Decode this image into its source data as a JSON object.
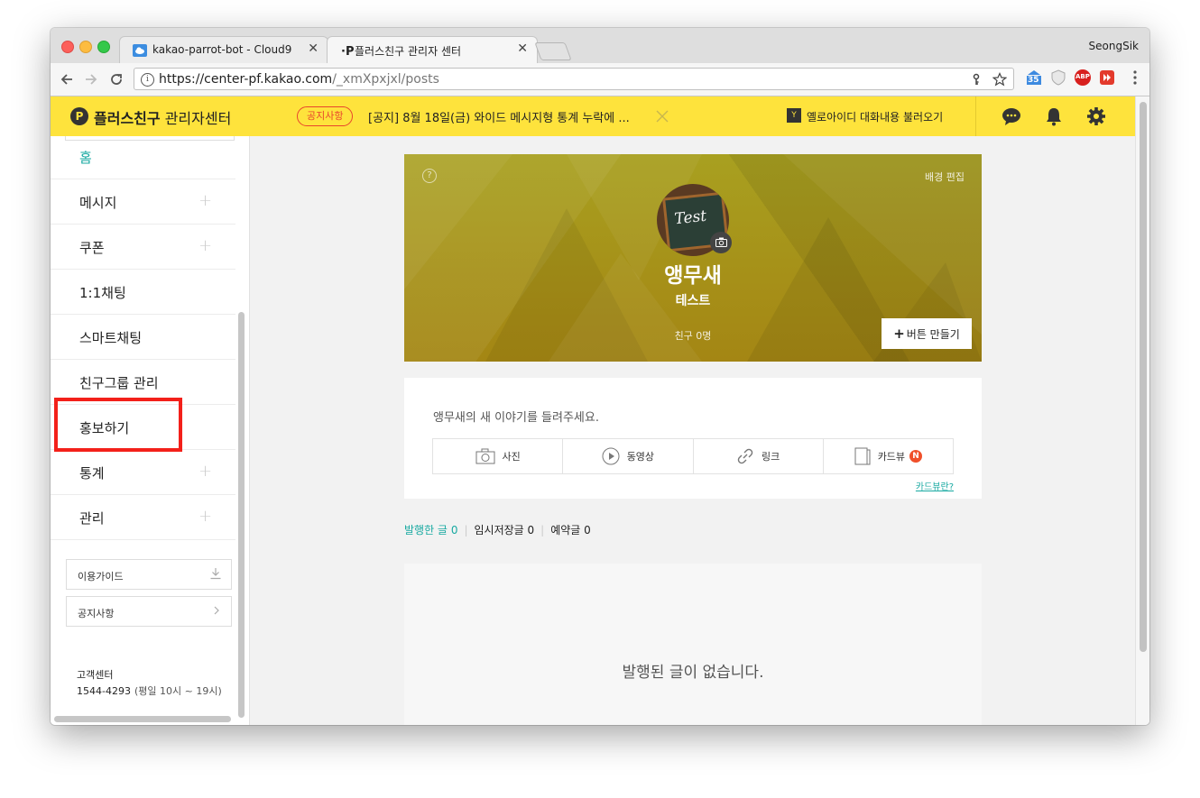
{
  "browser": {
    "tabs": [
      {
        "title": "kakao-parrot-bot - Cloud9",
        "active": false
      },
      {
        "title": "플러스친구 관리자 센터",
        "active": true
      }
    ],
    "close_glyph": "✕",
    "profile_name": "SeongSik",
    "url_host": "https://center-pf.kakao.com",
    "url_path": "/_xmXpxjxl/posts",
    "ext_badge_count": "35",
    "abp_label": "ABP"
  },
  "header": {
    "brand_bold": "플러스친구",
    "brand_rest": " 관리자센터",
    "notice_badge": "공지사항",
    "notice_text": "[공지] 8월 18일(금) 와이드 메시지형 통계 누락에 ...",
    "yellow_id_label": "옐로아이디 대화내용 불러오기"
  },
  "sidebar": {
    "items": [
      {
        "label": "홈",
        "active": true,
        "expandable": false
      },
      {
        "label": "메시지",
        "active": false,
        "expandable": true
      },
      {
        "label": "쿠폰",
        "active": false,
        "expandable": true
      },
      {
        "label": "1:1채팅",
        "active": false,
        "expandable": false
      },
      {
        "label": "스마트채팅",
        "active": false,
        "expandable": false
      },
      {
        "label": "친구그룹 관리",
        "active": false,
        "expandable": false
      },
      {
        "label": "홍보하기",
        "active": false,
        "expandable": false
      },
      {
        "label": "통계",
        "active": false,
        "expandable": true
      },
      {
        "label": "관리",
        "active": false,
        "expandable": true
      }
    ],
    "guide_button": "이용가이드",
    "notice_button": "공지사항",
    "cs_title": "고객센터",
    "cs_phone": "1544-4293",
    "cs_hours": "(평일 10시 ~ 19시)",
    "highlighted_item": "스마트채팅"
  },
  "profile": {
    "help_glyph": "?",
    "bg_edit": "배경 편집",
    "avatar_text": "Test",
    "name": "앵무새",
    "subtitle": "테스트",
    "friends": "친구 0명",
    "make_button": "버튼 만들기"
  },
  "composer": {
    "placeholder": "앵무새의 새 이야기를 들려주세요.",
    "tools": [
      {
        "label": "사진",
        "icon": "camera-icon"
      },
      {
        "label": "동영상",
        "icon": "play-icon"
      },
      {
        "label": "링크",
        "icon": "link-icon"
      },
      {
        "label": "카드뷰",
        "icon": "card-icon",
        "badge": "N"
      }
    ],
    "cardview_help": "카드뷰란?"
  },
  "post_tabs": [
    {
      "label": "발행한 글",
      "count": "0",
      "active": true
    },
    {
      "label": "임시저장글",
      "count": "0",
      "active": false
    },
    {
      "label": "예약글",
      "count": "0",
      "active": false
    }
  ],
  "empty_message": "발행된 글이 없습니다.",
  "colors": {
    "brand_yellow": "#fee33c",
    "accent_teal": "#17a9a1",
    "highlight_red": "#f3201a",
    "notice_red": "#e8452c"
  }
}
